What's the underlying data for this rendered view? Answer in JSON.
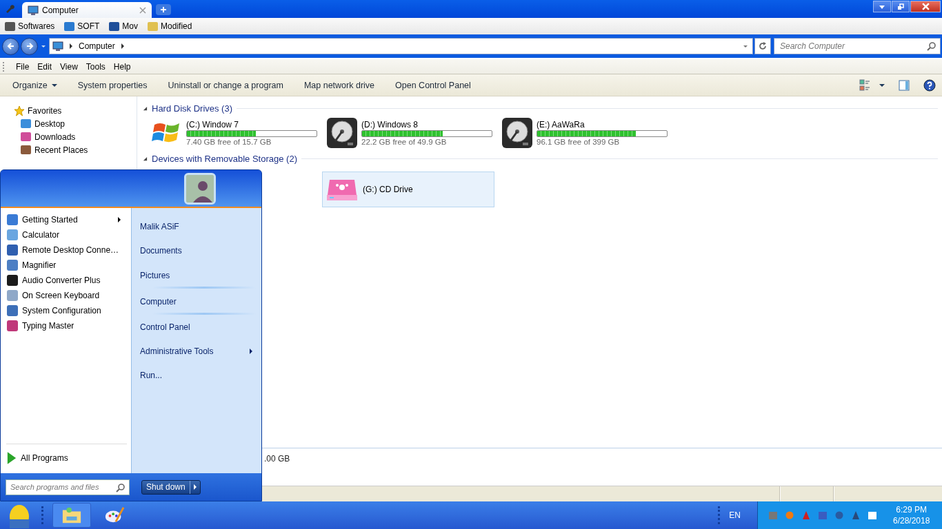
{
  "window": {
    "tab_title": "Computer"
  },
  "favorites_bar": [
    "Softwares",
    "SOFT",
    "Mov",
    "Modified"
  ],
  "address": {
    "crumbs": [
      "Computer"
    ]
  },
  "search": {
    "placeholder": "Search Computer"
  },
  "menu": [
    "File",
    "Edit",
    "View",
    "Tools",
    "Help"
  ],
  "commands": [
    {
      "label": "Organize",
      "dropdown": true
    },
    {
      "label": "System properties",
      "dropdown": false
    },
    {
      "label": "Uninstall or change a program",
      "dropdown": false
    },
    {
      "label": "Map network drive",
      "dropdown": false
    },
    {
      "label": "Open Control Panel",
      "dropdown": false
    }
  ],
  "navigation": {
    "header": "Favorites",
    "items": [
      "Desktop",
      "Downloads",
      "Recent Places"
    ]
  },
  "groups": [
    {
      "title": "Hard Disk Drives (3)",
      "items": [
        {
          "kind": "disk",
          "name": "(C:) Window 7",
          "free": "7.40 GB free of 15.7 GB",
          "level": 0.53,
          "selected": false
        },
        {
          "kind": "disk",
          "name": "(D:) Windows 8",
          "free": "22.2 GB free of 49.9 GB",
          "level": 0.62,
          "selected": false
        },
        {
          "kind": "disk",
          "name": "(E:) AaWaRa",
          "free": "96.1 GB free of 399 GB",
          "level": 0.76,
          "selected": false
        }
      ]
    },
    {
      "title": "Devices with Removable Storage (2)",
      "items": [
        {
          "kind": "removable",
          "name": "(G:) CD Drive",
          "selected": true
        }
      ]
    }
  ],
  "details_pane": {
    "text": ".00 GB"
  },
  "start_menu": {
    "programs": [
      {
        "label": "Getting Started",
        "submenu": true
      },
      {
        "label": "Calculator",
        "submenu": false
      },
      {
        "label": "Remote Desktop Conne…",
        "submenu": false
      },
      {
        "label": "Magnifier",
        "submenu": false
      },
      {
        "label": "Audio Converter Plus",
        "submenu": false
      },
      {
        "label": "On Screen Keyboard",
        "submenu": false
      },
      {
        "label": "System Configuration",
        "submenu": false
      },
      {
        "label": "Typing Master",
        "submenu": false
      }
    ],
    "all_programs": "All Programs",
    "places": [
      {
        "label": "Malik ASiF",
        "submenu": false,
        "separator_after": false
      },
      {
        "label": "Documents",
        "submenu": false,
        "separator_after": false
      },
      {
        "label": "Pictures",
        "submenu": false,
        "separator_after": true
      },
      {
        "label": "Computer",
        "submenu": false,
        "separator_after": true
      },
      {
        "label": "Control Panel",
        "submenu": false,
        "separator_after": false
      },
      {
        "label": "Administrative Tools",
        "submenu": true,
        "separator_after": false
      },
      {
        "label": "Run...",
        "submenu": false,
        "separator_after": false
      }
    ],
    "search_placeholder": "Search programs and files",
    "shutdown": "Shut down"
  },
  "taskbar": {
    "language": "EN",
    "time": "6:29 PM",
    "date": "6/28/2018"
  }
}
